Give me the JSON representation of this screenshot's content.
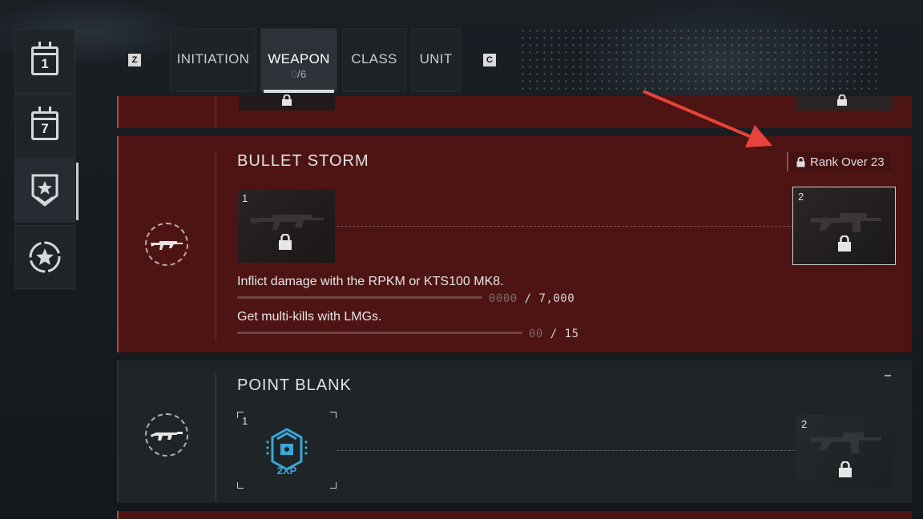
{
  "nav_keys": {
    "prev": "Z",
    "next": "C"
  },
  "tabs": [
    {
      "label": "INITIATION"
    },
    {
      "label": "WEAPON",
      "progress_done": "0",
      "progress_total": "/6"
    },
    {
      "label": "CLASS"
    },
    {
      "label": "UNIT"
    }
  ],
  "rail": {
    "daily_num": "1",
    "weekly_num": "7"
  },
  "challenges": [
    {
      "title": "BULLET STORM",
      "lock_requirement": "Rank Over 23",
      "reward1_num": "1",
      "reward2_num": "2",
      "objectives": [
        {
          "text": "Inflict damage with the RPKM or KTS100 MK8.",
          "current": "0000",
          "total": "/ 7,000"
        },
        {
          "text": "Get multi-kills with LMGs.",
          "current": "00",
          "total": "/ 15"
        }
      ]
    },
    {
      "title": "POINT BLANK",
      "reward1_num": "1",
      "reward1_badge": "2XP",
      "reward2_num": "2"
    }
  ],
  "colors": {
    "card_red": "#4e1414",
    "card_dark": "#1f2427",
    "accent_blue": "#3aa7d8",
    "arrow": "#e8433a"
  }
}
